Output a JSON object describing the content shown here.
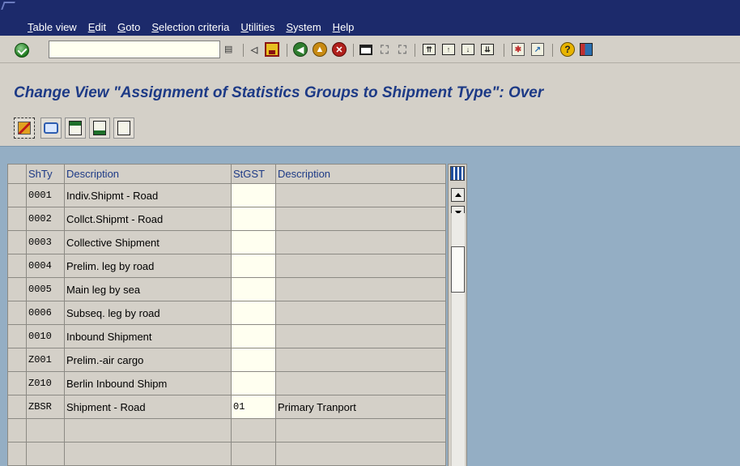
{
  "menu": {
    "items": [
      {
        "label": "Table view"
      },
      {
        "label": "Edit"
      },
      {
        "label": "Goto"
      },
      {
        "label": "Selection criteria"
      },
      {
        "label": "Utilities"
      },
      {
        "label": "System"
      },
      {
        "label": "Help"
      }
    ]
  },
  "toolbar": {
    "command_value": "",
    "dropdown_glyph": "▤",
    "icons": [
      "enter-icon",
      "save-icon",
      "back-icon",
      "exit-icon",
      "cancel-icon",
      "print-icon",
      "find-icon",
      "find-next-icon",
      "first-page-icon",
      "previous-page-icon",
      "next-page-icon",
      "last-page-icon",
      "create-session-icon",
      "shortcut-icon",
      "help-icon",
      "layout-icon"
    ]
  },
  "title": "Change View \"Assignment of Statistics Groups to Shipment Type\": Over",
  "app_toolbar": {
    "icons": [
      "display-change-icon",
      "undo-icon",
      "select-all-icon",
      "select-block-icon",
      "deselect-all-icon"
    ]
  },
  "table": {
    "columns": [
      "ShTy",
      "Description",
      "StGST",
      "Description"
    ],
    "rows": [
      {
        "code": "0001",
        "desc": "Indiv.Shipmt - Road",
        "stgst": "",
        "desc2": ""
      },
      {
        "code": "0002",
        "desc": "Collct.Shipmt - Road",
        "stgst": "",
        "desc2": ""
      },
      {
        "code": "0003",
        "desc": "Collective Shipment",
        "stgst": "",
        "desc2": ""
      },
      {
        "code": "0004",
        "desc": "Prelim. leg by road",
        "stgst": "",
        "desc2": ""
      },
      {
        "code": "0005",
        "desc": "Main leg by sea",
        "stgst": "",
        "desc2": ""
      },
      {
        "code": "0006",
        "desc": "Subseq. leg by road",
        "stgst": "",
        "desc2": ""
      },
      {
        "code": "0010",
        "desc": "Inbound Shipment",
        "stgst": "",
        "desc2": ""
      },
      {
        "code": "Z001",
        "desc": "Prelim.-air cargo",
        "stgst": "",
        "desc2": ""
      },
      {
        "code": "Z010",
        "desc": "Berlin Inbound Shipm",
        "stgst": "",
        "desc2": ""
      },
      {
        "code": "ZBSR",
        "desc": "Shipment - Road",
        "stgst": "01",
        "desc2": "Primary Tranport"
      },
      {
        "code": "",
        "desc": "",
        "stgst": "",
        "desc2": ""
      },
      {
        "code": "",
        "desc": "",
        "stgst": "",
        "desc2": ""
      }
    ]
  }
}
